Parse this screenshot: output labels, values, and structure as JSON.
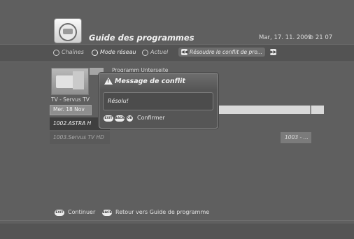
{
  "header": {
    "title": "Guide des programmes",
    "date": "Mar, 17. 11. 2009",
    "time": "21 07",
    "clock_icon": "clock-icon"
  },
  "nav": {
    "items": [
      {
        "label": "Chaînes",
        "selected": false
      },
      {
        "label": "Mode réseau",
        "selected": true
      },
      {
        "label": "Actuel",
        "selected": false
      }
    ],
    "resolve_label": "Résoudre le conflit de pro..."
  },
  "guide": {
    "channel_name": "TV - Servus TV",
    "day": "Mer. 18 Nov",
    "program_label": "Programm Unterseite",
    "rows": [
      {
        "channel": "1002.ASTRA H",
        "highlighted": true
      },
      {
        "channel": "1003.Servus TV HD",
        "highlighted": false
      }
    ],
    "row2_program": "1003 - ..."
  },
  "dialog": {
    "title": "Message de conflit",
    "message": "Résolu!",
    "keys": [
      "EXIT",
      "BACK",
      "OK"
    ],
    "confirm_label": "Confirmer"
  },
  "footer": {
    "exit_key": "EXIT",
    "continue_label": "Continuer",
    "back_key": "BACK",
    "back_label": "Retour vers Guide de programme"
  },
  "colors": {
    "background": "#5f5f5f",
    "highlight_row": "#3f3f3f",
    "timeline": "#d9d9d9"
  }
}
